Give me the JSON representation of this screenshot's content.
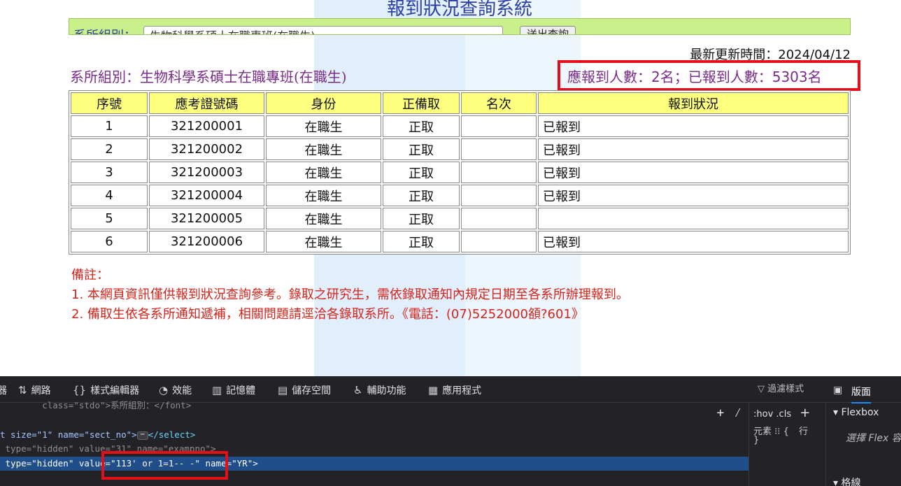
{
  "page": {
    "title": "報到狀況查詢系統",
    "filter_label": "系所組別：",
    "filter_select_value": "生物科學系碩士在職專班(在職生)",
    "filter_button": "送出查詢",
    "updated_label": "最新更新時間：2024/04/12",
    "dept_label": "系所組別：生物科學系碩士在職專班(在職生)",
    "counts": {
      "expected_label": "應報到人數：",
      "expected_value": "2",
      "expected_unit": "名；已報到人數：",
      "reported_value": "5303",
      "reported_unit": "名"
    },
    "table": {
      "headers": [
        "序號",
        "應考證號碼",
        "身份",
        "正備取",
        "名次",
        "報到狀況"
      ],
      "rows": [
        [
          "1",
          "321200001",
          "在職生",
          "正取",
          "",
          "已報到"
        ],
        [
          "2",
          "321200002",
          "在職生",
          "正取",
          "",
          "已報到"
        ],
        [
          "3",
          "321200003",
          "在職生",
          "正取",
          "",
          "已報到"
        ],
        [
          "4",
          "321200004",
          "在職生",
          "正取",
          "",
          "已報到"
        ],
        [
          "5",
          "321200005",
          "在職生",
          "正取",
          "",
          ""
        ],
        [
          "6",
          "321200006",
          "在職生",
          "正取",
          "",
          "已報到"
        ]
      ]
    },
    "notes": {
      "heading": "備註：",
      "line1": "1. 本網頁資訊僅供報到狀況查詢參考。錄取之研究生，需依錄取通知內規定日期至各系所辦理報到。",
      "line2": "2. 備取生依各系所通知遞補，相關問題請逕洽各錄取系所。《電話：(07)5252000頟?601》"
    }
  },
  "devtools": {
    "tabs": [
      {
        "icon": "network-icon",
        "glyph": "⇅",
        "label": "網路"
      },
      {
        "icon": "style-editor-icon",
        "glyph": "{}",
        "label": "樣式編輯器"
      },
      {
        "icon": "performance-icon",
        "glyph": "◔",
        "label": "效能"
      },
      {
        "icon": "memory-icon",
        "glyph": "▥",
        "label": "記憶體"
      },
      {
        "icon": "storage-icon",
        "glyph": "▤",
        "label": "儲存空間"
      },
      {
        "icon": "accessibility-icon",
        "glyph": "♿",
        "label": "輔助功能"
      },
      {
        "icon": "application-icon",
        "glyph": "▦",
        "label": "應用程式"
      }
    ],
    "code_lines": {
      "line0": "        class=\"stdo\">系所組別：</font>",
      "line1_a": "t size=\"1\" name=\"sect_no\">",
      "line1_b": "</select>",
      "line2": " type=\"hidden\" value=\"31\" name=\"exampno\">",
      "line3": " type=\"hidden\" value=\"113' or 1=1-- -\" name=\"YR\">"
    },
    "rules": {
      "filter": "過濾樣式",
      "hov": ":hov",
      "cls": ".cls",
      "element": "元素",
      "brace_open": "{",
      "inline": "行",
      "brace_close": "}"
    },
    "layout": {
      "tab": "版面",
      "flexbox": "Flexbox",
      "flex_hint": "選擇 Flex 容",
      "grid": "格線"
    }
  }
}
